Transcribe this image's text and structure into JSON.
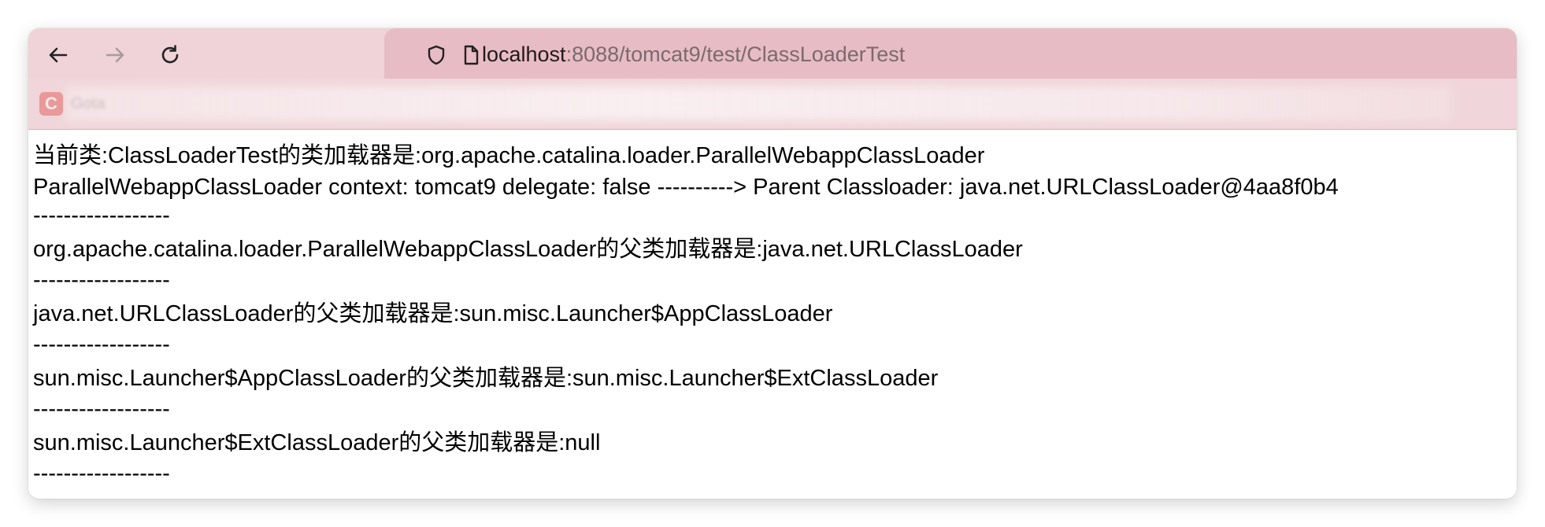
{
  "toolbar": {
    "back_icon": "arrow-left-icon",
    "forward_icon": "arrow-right-icon",
    "reload_icon": "reload-icon"
  },
  "url_bar": {
    "host": "localhost",
    "rest": ":8088/tomcat9/test/ClassLoaderTest",
    "security_icon": "shield-icon",
    "page_icon": "document-icon"
  },
  "bookmarks": {
    "items": [
      {
        "favicon_letter": "C",
        "label": "Gota"
      }
    ]
  },
  "page": {
    "lines": [
      "当前类:ClassLoaderTest的类加载器是:org.apache.catalina.loader.ParallelWebappClassLoader",
      "ParallelWebappClassLoader context: tomcat9 delegate: false ----------> Parent Classloader: java.net.URLClassLoader@4aa8f0b4",
      "------------------",
      "org.apache.catalina.loader.ParallelWebappClassLoader的父类加载器是:java.net.URLClassLoader",
      "------------------",
      "java.net.URLClassLoader的父类加载器是:sun.misc.Launcher$AppClassLoader",
      "------------------",
      "sun.misc.Launcher$AppClassLoader的父类加载器是:sun.misc.Launcher$ExtClassLoader",
      "------------------",
      "sun.misc.Launcher$ExtClassLoader的父类加载器是:null",
      "------------------"
    ]
  }
}
